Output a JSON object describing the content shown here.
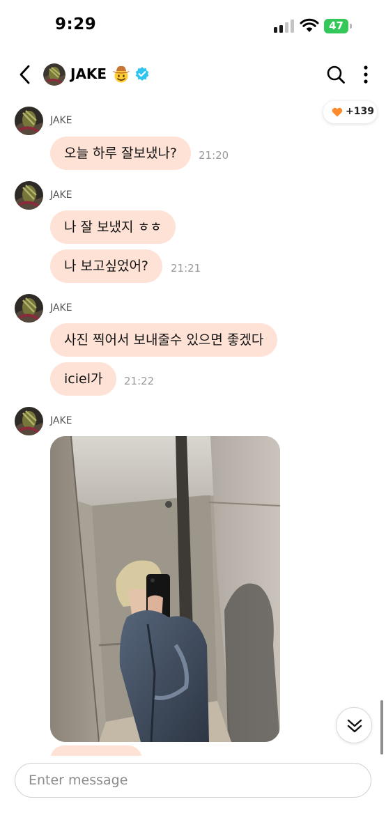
{
  "status_bar": {
    "time": "9:29",
    "battery": "47"
  },
  "header": {
    "name": "JAKE",
    "emoji_icon": "cowboy-hat-face-emoji",
    "verified_icon": "verified-badge-icon"
  },
  "hearts": {
    "count": "+139",
    "color": "#ff8a2b"
  },
  "messages": [
    {
      "sender": "JAKE",
      "bubbles": [
        "오늘 하루 잘보냈나?"
      ],
      "time": "21:20"
    },
    {
      "sender": "JAKE",
      "bubbles": [
        "나 잘 보냈지 ㅎㅎ",
        "나 보고싶었어?"
      ],
      "time": "21:21"
    },
    {
      "sender": "JAKE",
      "bubbles": [
        "사진 찍어서 보내줄수 있으면 좋겠다",
        "iciel가"
      ],
      "time": "21:22"
    },
    {
      "sender": "JAKE",
      "photo": "elevator-mirror-selfie"
    }
  ],
  "input": {
    "placeholder": "Enter message"
  },
  "colors": {
    "bubble": "#ffe2d6",
    "verified": "#2ec6f0",
    "battery": "#34c759"
  }
}
